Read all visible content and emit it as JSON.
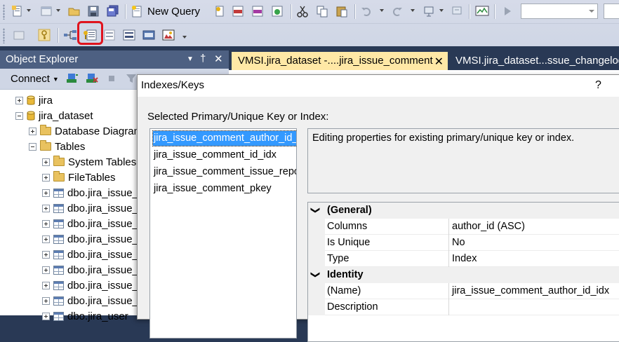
{
  "toolbar": {
    "new_query_label": "New Query"
  },
  "object_explorer": {
    "title": "Object Explorer",
    "pin_glyph": "↓",
    "pin2_glyph": "†",
    "close_glyph": "✕",
    "connect_label": "Connect",
    "tree": [
      {
        "label": "jira",
        "icon": "database-icon",
        "expander": "plus",
        "indent": 0
      },
      {
        "label": "jira_dataset",
        "icon": "database-icon",
        "expander": "minus",
        "indent": 0
      },
      {
        "label": "Database Diagrams",
        "icon": "folder-icon",
        "expander": "plus",
        "indent": 1
      },
      {
        "label": "Tables",
        "icon": "folder-icon",
        "expander": "minus",
        "indent": 1
      },
      {
        "label": "System Tables",
        "icon": "folder-icon",
        "expander": "plus",
        "indent": 2
      },
      {
        "label": "FileTables",
        "icon": "folder-icon",
        "expander": "plus",
        "indent": 2
      },
      {
        "label": "dbo.jira_issue_a",
        "icon": "table-icon",
        "expander": "plus",
        "indent": 2
      },
      {
        "label": "dbo.jira_issue_a",
        "icon": "table-icon",
        "expander": "plus",
        "indent": 2
      },
      {
        "label": "dbo.jira_issue_b",
        "icon": "table-icon",
        "expander": "plus",
        "indent": 2
      },
      {
        "label": "dbo.jira_issue_c",
        "icon": "table-icon",
        "expander": "plus",
        "indent": 2
      },
      {
        "label": "dbo.jira_issue_c",
        "icon": "table-icon",
        "expander": "plus",
        "indent": 2
      },
      {
        "label": "dbo.jira_issue_f",
        "icon": "table-icon",
        "expander": "plus",
        "indent": 2
      },
      {
        "label": "dbo.jira_issue_r",
        "icon": "table-icon",
        "expander": "plus",
        "indent": 2
      },
      {
        "label": "dbo.jira_issue_s",
        "icon": "table-icon",
        "expander": "plus",
        "indent": 2
      },
      {
        "label": "dbo.jira_user",
        "icon": "table-icon",
        "expander": "plus",
        "indent": 2
      }
    ]
  },
  "tabs": [
    {
      "label": "VMSI.jira_dataset -....jira_issue_comment",
      "active": true,
      "close_glyph": "✕"
    },
    {
      "label": "VMSI.jira_dataset...ssue_changelog_it",
      "active": false
    }
  ],
  "dialog": {
    "title": "Indexes/Keys",
    "help_glyph": "?",
    "list_label": "Selected Primary/Unique Key or Index:",
    "keys": [
      {
        "label": "jira_issue_comment_author_id_idx",
        "selected": true
      },
      {
        "label": "jira_issue_comment_id_idx",
        "selected": false
      },
      {
        "label": "jira_issue_comment_issue_report_id_idx",
        "selected": false
      },
      {
        "label": "jira_issue_comment_pkey",
        "selected": false
      }
    ],
    "description": "Editing properties for existing primary/unique key or index.",
    "properties": [
      {
        "kind": "category",
        "name": "(General)",
        "chevron": "❯"
      },
      {
        "kind": "prop",
        "name": "Columns",
        "value": "author_id (ASC)"
      },
      {
        "kind": "prop",
        "name": "Is Unique",
        "value": "No"
      },
      {
        "kind": "prop",
        "name": "Type",
        "value": "Index"
      },
      {
        "kind": "category",
        "name": "Identity",
        "chevron": "❯"
      },
      {
        "kind": "prop",
        "name": "(Name)",
        "value": "jira_issue_comment_author_id_idx"
      },
      {
        "kind": "prop",
        "name": "Description",
        "value": ""
      }
    ]
  },
  "colors": {
    "panel_title_bg": "#4d6082",
    "active_tab_bg": "#ffe8a6",
    "selection_bg": "#3399ff",
    "highlight_border": "#e0141e"
  }
}
